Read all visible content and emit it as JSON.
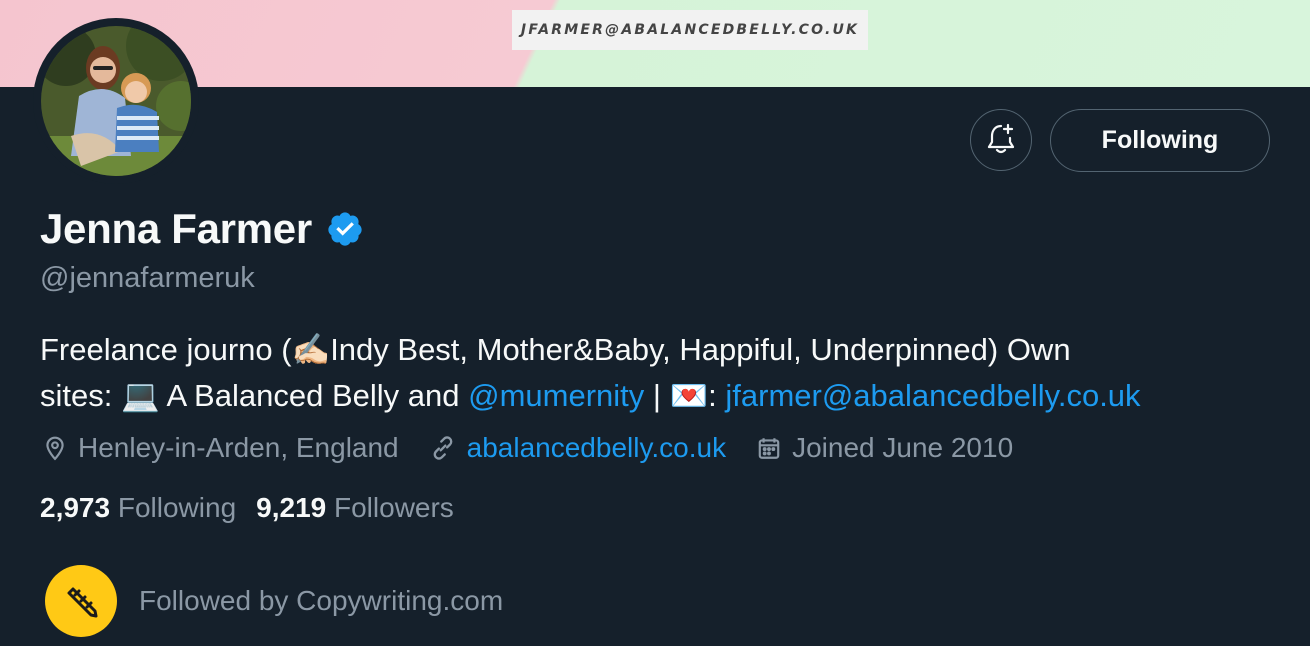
{
  "banner": {
    "email_text": "JFARMER@ABALANCEDBELLY.CO.UK"
  },
  "actions": {
    "notify_icon": "bell-plus-icon",
    "following_label": "Following"
  },
  "profile": {
    "display_name": "Jenna Farmer",
    "verified_icon": "verified-badge-icon",
    "handle": "@jennafarmeruk"
  },
  "bio": {
    "l1_text": "Freelance journo (",
    "l1_emoji": "✍🏻",
    "l1_rest": "Indy Best, Mother&Baby, Happiful, Underpinned) Own",
    "l2_text_a": "sites: ",
    "l2_emoji_laptop": "💻",
    "l2_text_b": " A Balanced Belly and ",
    "l2_mention": "@mumernity",
    "l2_sep": " | ",
    "l2_emoji_mail": "💌",
    "l2_colon": ": ",
    "l2_email": "jfarmer@abalancedbelly.co.uk"
  },
  "meta": {
    "location": "Henley-in-Arden, England",
    "website": "abalancedbelly.co.uk",
    "joined": "Joined June 2010"
  },
  "stats": {
    "following_count": "2,973",
    "following_label": "Following",
    "followers_count": "9,219",
    "followers_label": "Followers"
  },
  "followed_by": {
    "text": "Followed by Copywriting.com"
  },
  "colors": {
    "background": "#15202b",
    "accent": "#1d9bf0",
    "secondary_text": "#8b98a5",
    "badge_yellow": "#ffc915"
  }
}
